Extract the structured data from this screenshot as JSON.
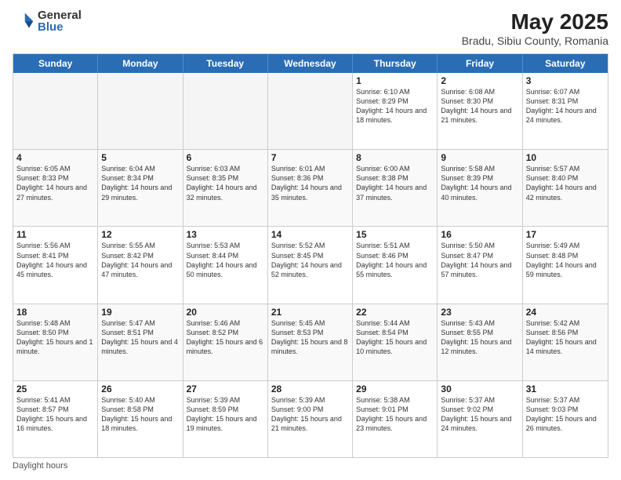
{
  "logo": {
    "general": "General",
    "blue": "Blue"
  },
  "title": "May 2025",
  "subtitle": "Bradu, Sibiu County, Romania",
  "days_of_week": [
    "Sunday",
    "Monday",
    "Tuesday",
    "Wednesday",
    "Thursday",
    "Friday",
    "Saturday"
  ],
  "footer": "Daylight hours",
  "weeks": [
    [
      {
        "day": "",
        "info": "",
        "empty": true
      },
      {
        "day": "",
        "info": "",
        "empty": true
      },
      {
        "day": "",
        "info": "",
        "empty": true
      },
      {
        "day": "",
        "info": "",
        "empty": true
      },
      {
        "day": "1",
        "info": "Sunrise: 6:10 AM\nSunset: 8:29 PM\nDaylight: 14 hours\nand 18 minutes."
      },
      {
        "day": "2",
        "info": "Sunrise: 6:08 AM\nSunset: 8:30 PM\nDaylight: 14 hours\nand 21 minutes."
      },
      {
        "day": "3",
        "info": "Sunrise: 6:07 AM\nSunset: 8:31 PM\nDaylight: 14 hours\nand 24 minutes."
      }
    ],
    [
      {
        "day": "4",
        "info": "Sunrise: 6:05 AM\nSunset: 8:33 PM\nDaylight: 14 hours\nand 27 minutes."
      },
      {
        "day": "5",
        "info": "Sunrise: 6:04 AM\nSunset: 8:34 PM\nDaylight: 14 hours\nand 29 minutes."
      },
      {
        "day": "6",
        "info": "Sunrise: 6:03 AM\nSunset: 8:35 PM\nDaylight: 14 hours\nand 32 minutes."
      },
      {
        "day": "7",
        "info": "Sunrise: 6:01 AM\nSunset: 8:36 PM\nDaylight: 14 hours\nand 35 minutes."
      },
      {
        "day": "8",
        "info": "Sunrise: 6:00 AM\nSunset: 8:38 PM\nDaylight: 14 hours\nand 37 minutes."
      },
      {
        "day": "9",
        "info": "Sunrise: 5:58 AM\nSunset: 8:39 PM\nDaylight: 14 hours\nand 40 minutes."
      },
      {
        "day": "10",
        "info": "Sunrise: 5:57 AM\nSunset: 8:40 PM\nDaylight: 14 hours\nand 42 minutes."
      }
    ],
    [
      {
        "day": "11",
        "info": "Sunrise: 5:56 AM\nSunset: 8:41 PM\nDaylight: 14 hours\nand 45 minutes."
      },
      {
        "day": "12",
        "info": "Sunrise: 5:55 AM\nSunset: 8:42 PM\nDaylight: 14 hours\nand 47 minutes."
      },
      {
        "day": "13",
        "info": "Sunrise: 5:53 AM\nSunset: 8:44 PM\nDaylight: 14 hours\nand 50 minutes."
      },
      {
        "day": "14",
        "info": "Sunrise: 5:52 AM\nSunset: 8:45 PM\nDaylight: 14 hours\nand 52 minutes."
      },
      {
        "day": "15",
        "info": "Sunrise: 5:51 AM\nSunset: 8:46 PM\nDaylight: 14 hours\nand 55 minutes."
      },
      {
        "day": "16",
        "info": "Sunrise: 5:50 AM\nSunset: 8:47 PM\nDaylight: 14 hours\nand 57 minutes."
      },
      {
        "day": "17",
        "info": "Sunrise: 5:49 AM\nSunset: 8:48 PM\nDaylight: 14 hours\nand 59 minutes."
      }
    ],
    [
      {
        "day": "18",
        "info": "Sunrise: 5:48 AM\nSunset: 8:50 PM\nDaylight: 15 hours\nand 1 minute."
      },
      {
        "day": "19",
        "info": "Sunrise: 5:47 AM\nSunset: 8:51 PM\nDaylight: 15 hours\nand 4 minutes."
      },
      {
        "day": "20",
        "info": "Sunrise: 5:46 AM\nSunset: 8:52 PM\nDaylight: 15 hours\nand 6 minutes."
      },
      {
        "day": "21",
        "info": "Sunrise: 5:45 AM\nSunset: 8:53 PM\nDaylight: 15 hours\nand 8 minutes."
      },
      {
        "day": "22",
        "info": "Sunrise: 5:44 AM\nSunset: 8:54 PM\nDaylight: 15 hours\nand 10 minutes."
      },
      {
        "day": "23",
        "info": "Sunrise: 5:43 AM\nSunset: 8:55 PM\nDaylight: 15 hours\nand 12 minutes."
      },
      {
        "day": "24",
        "info": "Sunrise: 5:42 AM\nSunset: 8:56 PM\nDaylight: 15 hours\nand 14 minutes."
      }
    ],
    [
      {
        "day": "25",
        "info": "Sunrise: 5:41 AM\nSunset: 8:57 PM\nDaylight: 15 hours\nand 16 minutes."
      },
      {
        "day": "26",
        "info": "Sunrise: 5:40 AM\nSunset: 8:58 PM\nDaylight: 15 hours\nand 18 minutes."
      },
      {
        "day": "27",
        "info": "Sunrise: 5:39 AM\nSunset: 8:59 PM\nDaylight: 15 hours\nand 19 minutes."
      },
      {
        "day": "28",
        "info": "Sunrise: 5:39 AM\nSunset: 9:00 PM\nDaylight: 15 hours\nand 21 minutes."
      },
      {
        "day": "29",
        "info": "Sunrise: 5:38 AM\nSunset: 9:01 PM\nDaylight: 15 hours\nand 23 minutes."
      },
      {
        "day": "30",
        "info": "Sunrise: 5:37 AM\nSunset: 9:02 PM\nDaylight: 15 hours\nand 24 minutes."
      },
      {
        "day": "31",
        "info": "Sunrise: 5:37 AM\nSunset: 9:03 PM\nDaylight: 15 hours\nand 26 minutes."
      }
    ]
  ]
}
